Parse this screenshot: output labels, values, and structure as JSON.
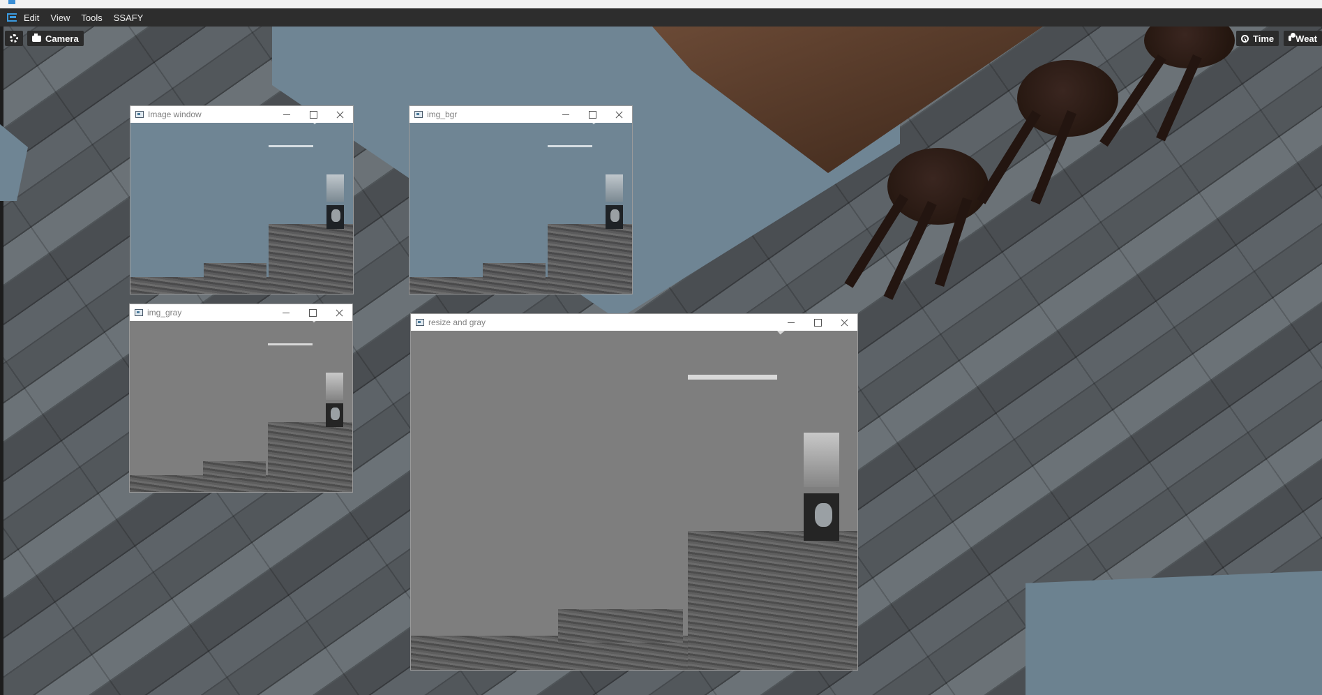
{
  "menu": {
    "items": [
      "Edit",
      "View",
      "Tools",
      "SSAFY"
    ]
  },
  "viewport_toolbar": {
    "camera_label": "Camera",
    "time_label": "Time",
    "weather_label": "Weat"
  },
  "windows": {
    "image_window": {
      "title": "Image window"
    },
    "img_bgr": {
      "title": "img_bgr"
    },
    "img_gray": {
      "title": "img_gray"
    },
    "resize_gray": {
      "title": "resize and gray"
    }
  },
  "colors": {
    "menu_bg": "#2d2d2d",
    "window_titlebar": "#ffffff",
    "sky_blue": "#6f8594",
    "table_wood": "#5a3d2c"
  }
}
